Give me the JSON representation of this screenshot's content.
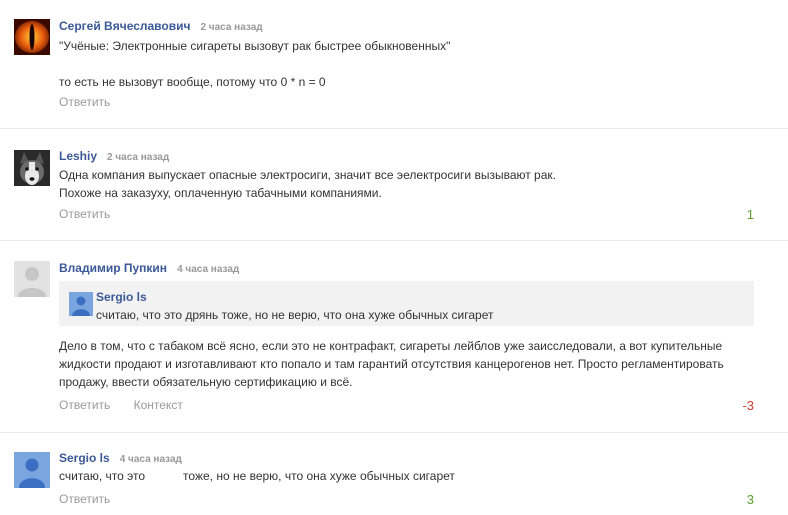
{
  "comments": [
    {
      "author": "Сергей Вячеславович",
      "time": "2 часа назад",
      "lines": [
        "\"Учёные: Электронные сигареты вызовут рак быстрее обыкновенных\"",
        "то есть не вызовут вообще, потому что 0 * n = 0"
      ],
      "reply": "Ответить",
      "score": ""
    },
    {
      "author": "Leshiy",
      "time": "2 часа назад",
      "lines": [
        "Одна компания выпускает опасные электросиги, значит все эелектросиги вызывают рак.",
        "Похоже на заказуху, оплаченную табачными компаниями."
      ],
      "reply": "Ответить",
      "score": "1"
    },
    {
      "author": "Владимир Пупкин",
      "time": "4 часа назад",
      "quote": {
        "author": "Sergio ls",
        "text": "считаю, что это дрянь тоже, но не верю, что она хуже обычных сигарет"
      },
      "lines": [
        "Дело в том, что с табаком всё ясно, если это не контрафакт, сигареты лейблов уже заисследовали, а вот купительные",
        "жидкости продают и изготавливают кто попало и там гарантий отсутствия канцерогенов нет. Просто регламентировать",
        "продажу, ввести обязательную сертификацию и всё."
      ],
      "reply": "Ответить",
      "context": "Контекст",
      "score": "-3"
    },
    {
      "author": "Sergio ls",
      "time": "4 часа назад",
      "lines": [
        "считаю, что это",
        "тоже, но не верю, что она хуже обычных сигарет"
      ],
      "reply": "Ответить",
      "score": "3"
    }
  ],
  "colors": {
    "link": "#3b5998",
    "positive": "#5a9f2a",
    "negative": "#d53b2e"
  }
}
